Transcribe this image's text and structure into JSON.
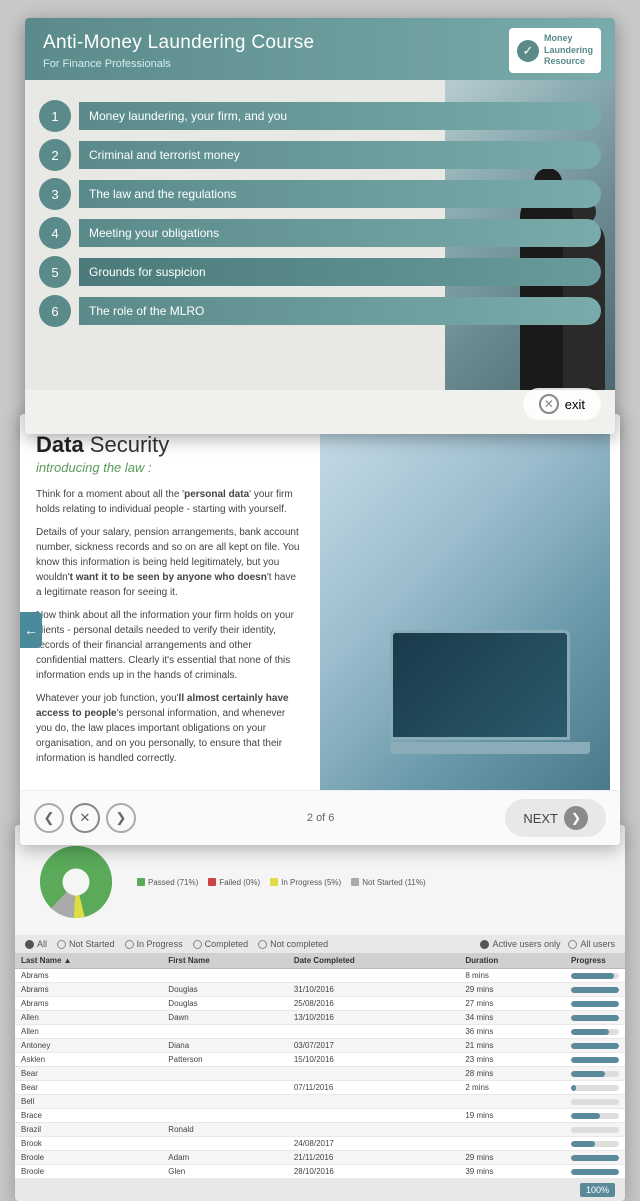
{
  "slide1": {
    "course_title": "Anti-Money Laundering Course",
    "subtitle": "For Finance Professionals",
    "logo_line1": "Money",
    "logo_line2": "Laundering",
    "logo_line3": "Resource",
    "menu_items": [
      {
        "num": "1",
        "label": "Money laundering, your firm, and you",
        "active": false
      },
      {
        "num": "2",
        "label": "Criminal and terrorist money",
        "active": false
      },
      {
        "num": "3",
        "label": "The law and the regulations",
        "active": false
      },
      {
        "num": "4",
        "label": "Meeting your obligations",
        "active": false
      },
      {
        "num": "5",
        "label": "Grounds for suspicion",
        "active": true
      },
      {
        "num": "6",
        "label": "The role of the MLRO",
        "active": false
      }
    ],
    "exit_label": "exit"
  },
  "slide2": {
    "title_bold": "Data",
    "title_rest": " Security",
    "subtitle": "introducing the law :",
    "paragraphs": [
      "Think for a moment about all the 'personal data' your firm holds relating to individual people - starting with yourself.",
      "Details of your salary, pension arrangements, bank account number, sickness records and so on are all kept on file. You know this information is being held legitimately, but you wouldn't want it to be seen by anyone who doesn't have a legitimate reason for seeing it.",
      "Now think about all the information your firm holds on your clients - personal details needed to verify their identity, records of their financial arrangements and other confidential matters. Clearly it's essential that none of this information ends up in the hands of criminals.",
      "Whatever your job function, you'll almost certainly have access to people's personal information, and whenever you do, the law places important obligations on your organisation, and on you personally, to ensure that their information is handled correctly."
    ],
    "page_indicator": "2 of 6",
    "next_label": "NEXT"
  },
  "slide3": {
    "legend": [
      {
        "label": "Passed (71%)",
        "color": "#5aaa5a"
      },
      {
        "label": "Failed (0%)",
        "color": "#cc4444"
      },
      {
        "label": "In Progress (5%)",
        "color": "#dddd44"
      },
      {
        "label": "Not Started (11%)",
        "color": "#aaaaaa"
      }
    ],
    "filters": {
      "status_options": [
        "All",
        "Not Started",
        "In Progress",
        "Completed",
        "Not completed"
      ],
      "user_options": [
        "Active users only",
        "All users"
      ]
    },
    "table_headers": [
      "Last Name",
      "First Name",
      "Date Completed",
      "Duration",
      "Progress"
    ],
    "table_rows": [
      {
        "last": "Abrams",
        "first": "",
        "date": "",
        "duration": "8 mins",
        "progress": 90
      },
      {
        "last": "Abrams",
        "first": "Douglas",
        "date": "31/10/2016",
        "duration": "29 mins",
        "progress": 100
      },
      {
        "last": "Abrams",
        "first": "Douglas",
        "date": "25/08/2016",
        "duration": "27 mins",
        "progress": 100
      },
      {
        "last": "Allen",
        "first": "Dawn",
        "date": "13/10/2016",
        "duration": "34 mins",
        "progress": 100
      },
      {
        "last": "Allen",
        "first": "",
        "date": "",
        "duration": "36 mins",
        "progress": 80
      },
      {
        "last": "Antoney",
        "first": "Diana",
        "date": "03/07/2017",
        "duration": "21 mins",
        "progress": 100
      },
      {
        "last": "Asklen",
        "first": "Patterson",
        "date": "15/10/2016",
        "duration": "23 mins",
        "progress": 100
      },
      {
        "last": "Bear",
        "first": "",
        "date": "",
        "duration": "28 mins",
        "progress": 70
      },
      {
        "last": "Bear",
        "first": "",
        "date": "07/11/2016",
        "duration": "2 mins",
        "progress": 10
      },
      {
        "last": "Bell",
        "first": "",
        "date": "",
        "duration": "",
        "progress": 0
      },
      {
        "last": "Brace",
        "first": "",
        "date": "",
        "duration": "19 mins",
        "progress": 60
      },
      {
        "last": "Brazil",
        "first": "Ronald",
        "date": "",
        "duration": "",
        "progress": 0
      },
      {
        "last": "Brook",
        "first": "",
        "date": "24/08/2017",
        "duration": "",
        "progress": 50
      },
      {
        "last": "Broole",
        "first": "Adam",
        "date": "21/11/2016",
        "duration": "29 mins",
        "progress": 100
      },
      {
        "last": "Broole",
        "first": "Glen",
        "date": "28/10/2016",
        "duration": "39 mins",
        "progress": 100
      }
    ],
    "zoom_label": "100%"
  }
}
